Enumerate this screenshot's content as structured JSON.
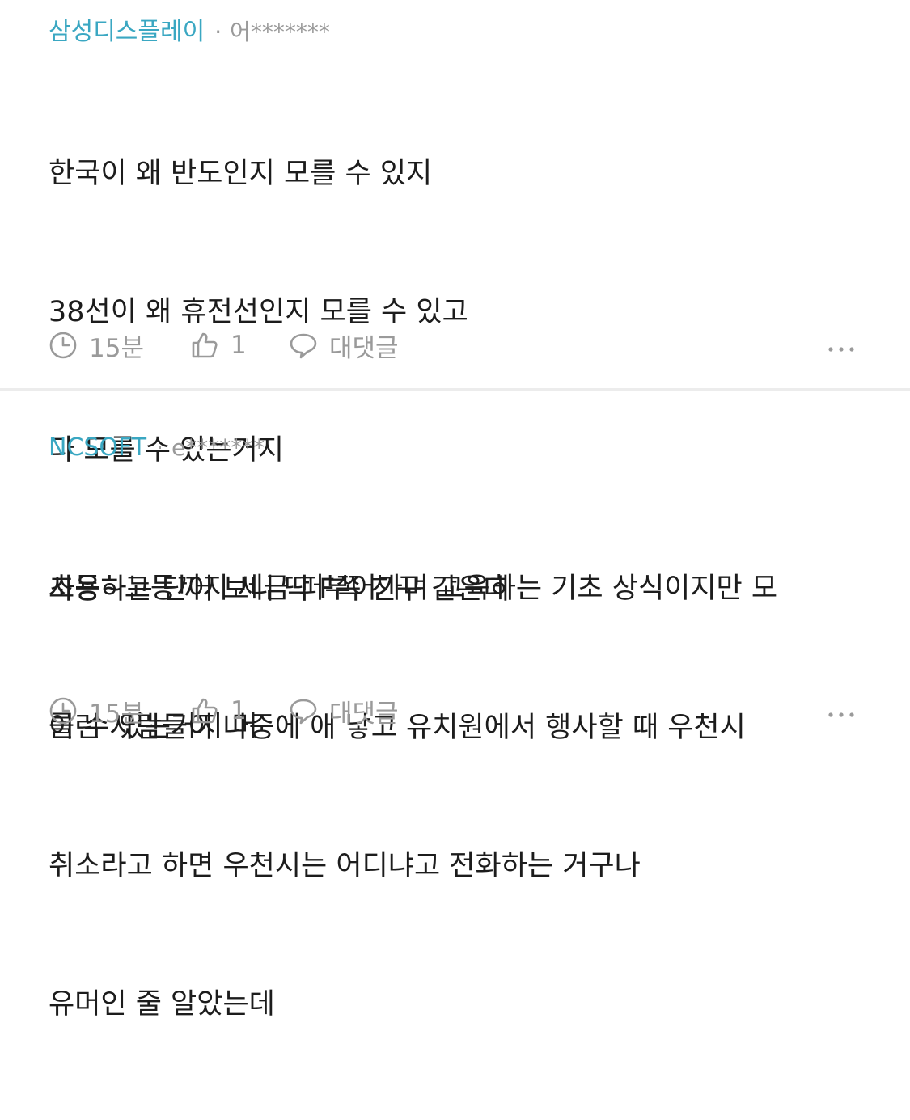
{
  "comments": [
    {
      "company": "삼성디스플레이",
      "separator": "·",
      "user": "어*******",
      "lines": [
        "한국이 왜 반도인지 모를 수 있지",
        "38선이 왜 휴전선인지 모를 수 있고",
        "다 모를 수 있는거지",
        "초등~고등까지 세금 퍼부어가며 교육하는 기초 상식이지만 모",
        "를 수 있는거지 머"
      ],
      "time": "15분",
      "likes": "1",
      "reply_label": "대댓글"
    },
    {
      "company": "NCSOFT",
      "separator": "·",
      "user": "e*******",
      "lines": [
        "사용하는 단어 보니 딱 F쪽 친구 같은데",
        "이런 사람들이 나중에 애 낳고 유치원에서 행사할 때 우천시",
        "취소라고 하면 우천시는 어디냐고 전화하는 거구나",
        "유머인 줄 알았는데"
      ],
      "time": "15분",
      "likes": "1",
      "reply_label": "대댓글"
    }
  ],
  "colors": {
    "company": "#3aa7c2",
    "meta_gray": "#9a9a9a",
    "text": "#1c1c1c",
    "divider": "#ececec"
  },
  "icons": {
    "time": "clock-icon",
    "like": "thumbs-up-icon",
    "reply": "speech-bubble-icon",
    "more": "more-dots-icon"
  }
}
